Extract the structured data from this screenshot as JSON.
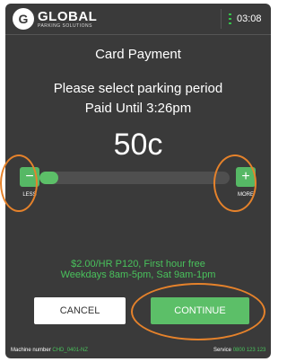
{
  "header": {
    "logo_letter": "G",
    "brand": "GLOBAL",
    "brand_sub": "PARKING SOLUTIONS",
    "clock": "03:08",
    "signal_icon": "signal-bars-icon"
  },
  "screen": {
    "title": "Card Payment",
    "instruction": "Please select parking period",
    "paid_until": "Paid Until 3:26pm",
    "amount": "50c"
  },
  "slider": {
    "fill_fraction": 0.1,
    "less_symbol": "−",
    "less_label": "LESS",
    "more_symbol": "+",
    "more_label": "MORE"
  },
  "rate_info": {
    "line1": "$2.00/HR P120, First hour free",
    "line2": "Weekdays 8am-5pm, Sat 9am-1pm"
  },
  "actions": {
    "cancel_label": "CANCEL",
    "continue_label": "CONTINUE"
  },
  "footer": {
    "machine_label": "Machine number",
    "machine_value": "CHD_0401-NZ",
    "service_label": "Service",
    "service_value": "0800 123 123"
  },
  "colors": {
    "accent_green": "#5cbf68",
    "annotation_orange": "#e5822b",
    "screen_bg": "#3a3a3a"
  }
}
